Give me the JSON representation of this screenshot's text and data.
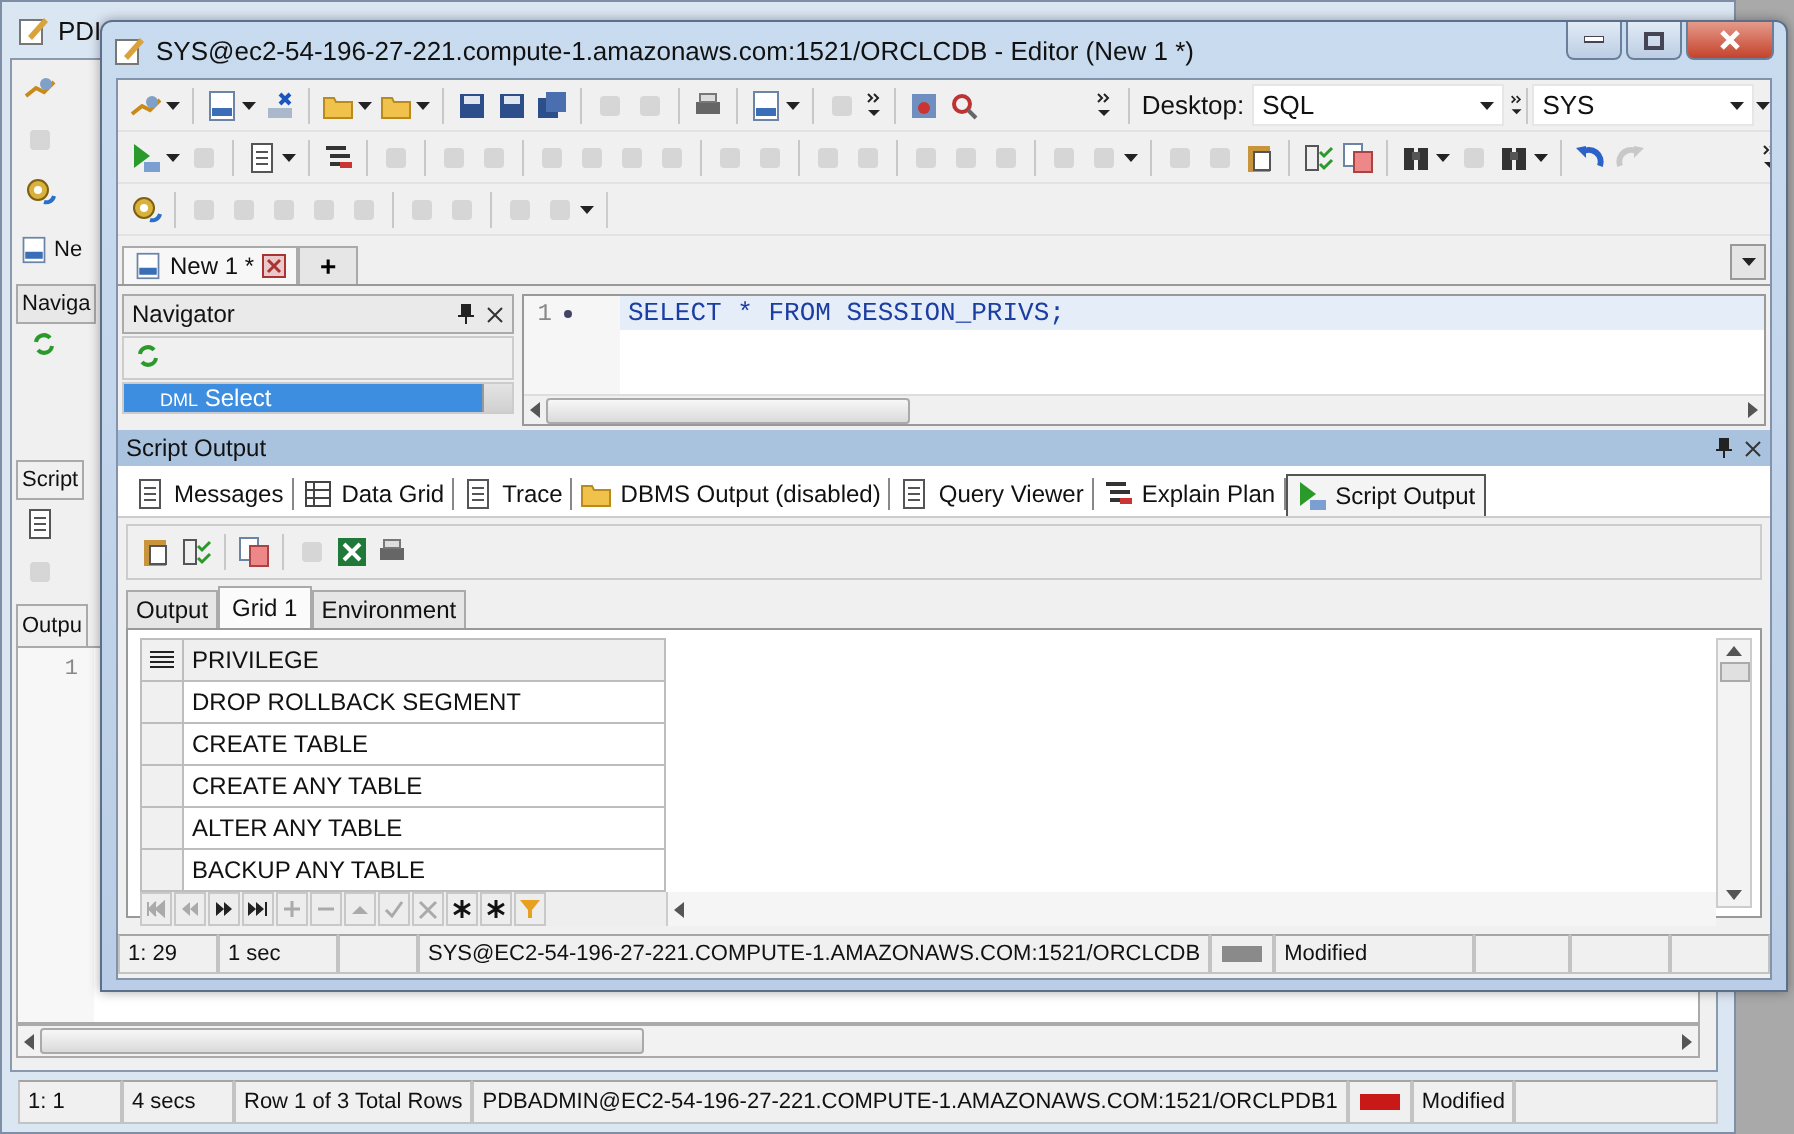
{
  "background_window": {
    "title": "PDI",
    "editor_tab": "Ne",
    "navigator": "Naviga",
    "script_tab": "Script",
    "output_tab": "Outpu",
    "line_number": "1",
    "status_bar": [
      {
        "kind": "text",
        "text": "1:  1"
      },
      {
        "kind": "text",
        "text": "4 secs"
      },
      {
        "kind": "text",
        "text": "Row 1 of 3 Total Rows"
      },
      {
        "kind": "text",
        "text": "PDBADMIN@EC2-54-196-27-221.COMPUTE-1.AMAZONAWS.COM:1521/ORCLPDB1"
      },
      {
        "kind": "connection",
        "color": "#c81818"
      },
      {
        "kind": "text",
        "text": "Modified"
      }
    ]
  },
  "window": {
    "title": "SYS@ec2-54-196-27-221.compute-1.amazonaws.com:1521/ORCLCDB - Editor (New 1 *)"
  },
  "toolbar": {
    "desktop_label": "Desktop:",
    "desktop_value": "SQL",
    "connection_value": "SYS"
  },
  "editor_tabs": [
    {
      "label": "New 1 *",
      "selected": true
    }
  ],
  "new_tab_button": "+",
  "navigator": {
    "title": "Navigator",
    "items": [
      {
        "tag": "DML",
        "label": "Select",
        "selected": true
      }
    ]
  },
  "editor": {
    "lines": [
      {
        "number": "1",
        "code": "SELECT * FROM SESSION_PRIVS;"
      }
    ]
  },
  "script_output": {
    "title": "Script Output",
    "tabs": [
      {
        "label": "Messages",
        "selected": false
      },
      {
        "label": "Data Grid",
        "selected": false
      },
      {
        "label": "Trace",
        "selected": false
      },
      {
        "label": "DBMS Output (disabled)",
        "selected": false
      },
      {
        "label": "Query Viewer",
        "selected": false
      },
      {
        "label": "Explain Plan",
        "selected": false
      },
      {
        "label": "Script Output",
        "selected": true
      }
    ],
    "sub_tabs": [
      {
        "label": "Output",
        "selected": false
      },
      {
        "label": "Grid 1",
        "selected": true
      },
      {
        "label": "Environment",
        "selected": false
      }
    ],
    "grid": {
      "columns": [
        "PRIVILEGE"
      ],
      "rows": [
        [
          "DROP ROLLBACK SEGMENT"
        ],
        [
          "CREATE TABLE"
        ],
        [
          "CREATE ANY TABLE"
        ],
        [
          "ALTER ANY TABLE"
        ],
        [
          "BACKUP ANY TABLE"
        ]
      ]
    }
  },
  "status_bar": [
    {
      "kind": "text",
      "text": "1: 29"
    },
    {
      "kind": "text",
      "text": "1 sec"
    },
    {
      "kind": "blank"
    },
    {
      "kind": "text",
      "text": "SYS@EC2-54-196-27-221.COMPUTE-1.AMAZONAWS.COM:1521/ORCLCDB"
    },
    {
      "kind": "connection",
      "color": "#8a8a8a"
    },
    {
      "kind": "text",
      "text": "Modified"
    }
  ]
}
